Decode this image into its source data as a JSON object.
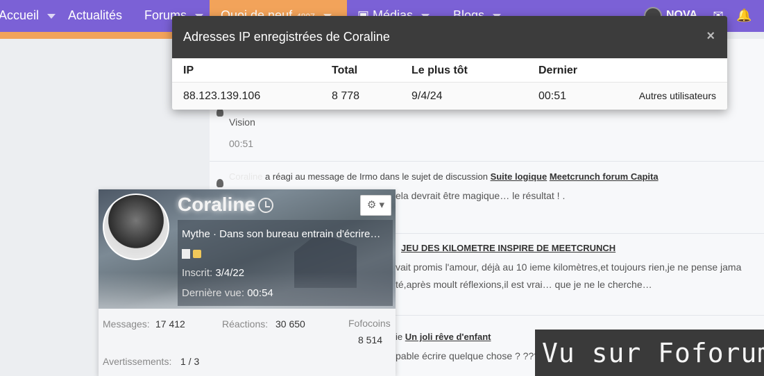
{
  "nav": {
    "items": [
      {
        "label": "Accueil"
      },
      {
        "label": "Actualités"
      },
      {
        "label": "Forums"
      },
      {
        "label": "Quoi de neuf",
        "badge": "4807"
      },
      {
        "label": "Médias"
      },
      {
        "label": "Blogs"
      }
    ],
    "username": "NOVA",
    "colors": {
      "primary": "#7b61d6",
      "accent": "#f2a35a"
    }
  },
  "feed": {
    "item1": {
      "text": "Vision",
      "time": "00:51"
    },
    "item2": {
      "user": "Coraline",
      "action": "a réagi au message de",
      "target_user": "Irmo",
      "context": "dans le sujet de discussion",
      "thread": "Suite logique",
      "thread2": "Meetcrunch forum Capita",
      "snippet": "ela devrait être magique… le résultat ! ."
    },
    "item3": {
      "thread": "JEU DES KILOMETRE INSPIRE DE MEETCRUNCH",
      "line1": "vait promis l'amour, déjà au 10 ieme kilomètres,et toujours rien,je ne pense jama",
      "line2": "té,après moult réflexions,il est vrai… que je ne le cherche…"
    },
    "item4": {
      "prefix": "ie",
      "thread": "Un joli rêve d'enfant",
      "snippet": "pable écrire quelque chose ? ???"
    }
  },
  "ip_modal": {
    "title": "Adresses IP enregistrées de Coraline",
    "close_symbol": "×",
    "headers": {
      "ip": "IP",
      "total": "Total",
      "first": "Le plus tôt",
      "last": "Dernier"
    },
    "rows": [
      {
        "ip": "88.123.139.106",
        "total": "8 778",
        "first": "9/4/24",
        "last": "00:51",
        "action": "Autres utilisateurs"
      }
    ]
  },
  "member_card": {
    "name": "Coraline",
    "title": "Mythe · Dans son bureau entrain d'écrire…",
    "joined_label": "Inscrit:",
    "joined_value": "3/4/22",
    "last_seen_label": "Dernière vue:",
    "last_seen_value": "00:54",
    "gear_symbol": "⚙",
    "stats": {
      "messages_label": "Messages:",
      "messages_value": "17 412",
      "reactions_label": "Réactions:",
      "reactions_value": "30 650",
      "coins_label": "Fofocoins",
      "coins_value": "8 514",
      "warnings_label": "Avertissements:",
      "warnings_value": "1 / 3"
    }
  },
  "watermark": {
    "text": "Vu sur Foforum"
  }
}
